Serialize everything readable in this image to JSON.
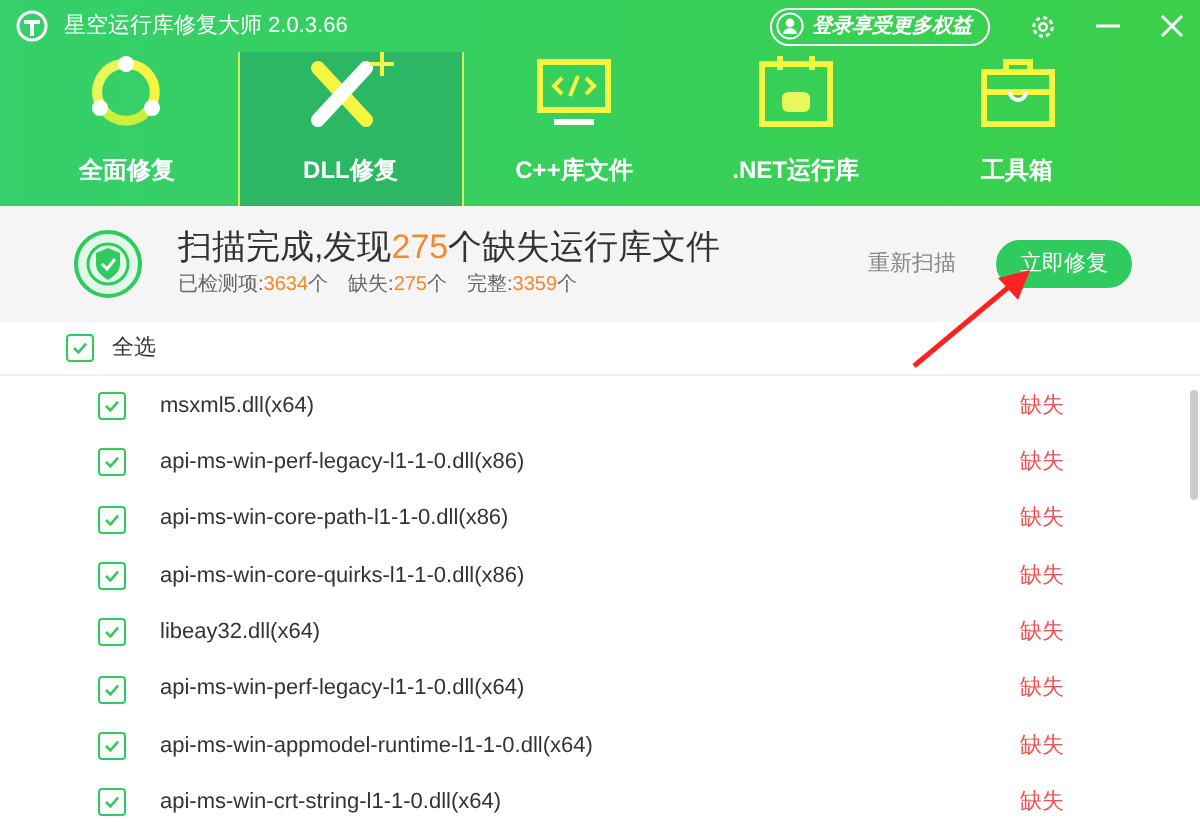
{
  "window": {
    "title": "星空运行库修复大师 2.0.3.66",
    "login": "登录享受更多权益"
  },
  "tabs": [
    {
      "label": "全面修复",
      "selected": false
    },
    {
      "label": "DLL修复",
      "selected": true
    },
    {
      "label": "C++库文件",
      "selected": false
    },
    {
      "label": ".NET运行库",
      "selected": false
    },
    {
      "label": "工具箱",
      "selected": false
    }
  ],
  "summary": {
    "prefix": "扫描完成,发现",
    "count": "275",
    "suffix": "个缺失运行库文件",
    "stats": [
      {
        "label": "已检测项:",
        "value": "3634",
        "unit": "个"
      },
      {
        "label": "缺失:",
        "value": "275",
        "unit": "个"
      },
      {
        "label": "完整:",
        "value": "3359",
        "unit": "个"
      }
    ],
    "rescan": "重新扫描",
    "repair": "立即修复"
  },
  "select_all": {
    "label": "全选",
    "checked": true
  },
  "files": [
    {
      "name": "msxml5.dll(x64)",
      "status": "缺失",
      "checked": true
    },
    {
      "name": "api-ms-win-perf-legacy-l1-1-0.dll(x86)",
      "status": "缺失",
      "checked": true
    },
    {
      "name": "api-ms-win-core-path-l1-1-0.dll(x86)",
      "status": "缺失",
      "checked": true
    },
    {
      "name": "api-ms-win-core-quirks-l1-1-0.dll(x86)",
      "status": "缺失",
      "checked": true
    },
    {
      "name": "libeay32.dll(x64)",
      "status": "缺失",
      "checked": true
    },
    {
      "name": "api-ms-win-perf-legacy-l1-1-0.dll(x64)",
      "status": "缺失",
      "checked": true
    },
    {
      "name": "api-ms-win-appmodel-runtime-l1-1-0.dll(x64)",
      "status": "缺失",
      "checked": true
    },
    {
      "name": "api-ms-win-crt-string-l1-1-0.dll(x64)",
      "status": "缺失",
      "checked": true
    }
  ]
}
